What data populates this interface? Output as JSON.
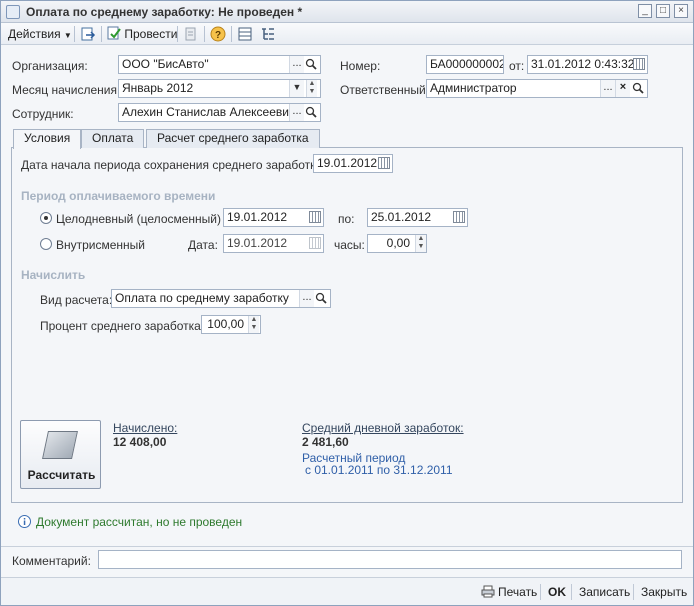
{
  "window": {
    "title": "Оплата по среднему заработку: Не проведен *",
    "controls": {
      "minimize": "_",
      "maximize": "□",
      "close": "×"
    }
  },
  "toolbar": {
    "actions_label": "Действия",
    "post_label": "Провести"
  },
  "header": {
    "org_label": "Организация:",
    "org_value": "ООО \"БисАвто\"",
    "number_label": "Номер:",
    "number_value": "БА000000002",
    "from_label": "от:",
    "date_value": "31.01.2012  0:43:32",
    "month_label": "Месяц начисления:",
    "month_value": "Январь 2012",
    "responsible_label": "Ответственный:",
    "responsible_value": "Администратор",
    "employee_label": "Сотрудник:",
    "employee_value": "Алехин Станислав Алексеевич"
  },
  "tabs": [
    {
      "label": "Условия",
      "active": true
    },
    {
      "label": "Оплата",
      "active": false
    },
    {
      "label": "Расчет среднего заработка",
      "active": false
    }
  ],
  "conditions": {
    "period_start_label": "Дата начала периода сохранения среднего заработка:",
    "period_start_value": "19.01.2012",
    "paid_period_title": "Период оплачиваемого времени",
    "fullday_label": "Целодневный (целосменный) с:",
    "fullday_from": "19.01.2012",
    "to_label": "по:",
    "fullday_to": "25.01.2012",
    "intrashift_label": "Внутрисменный",
    "date_label": "Дата:",
    "intrashift_date": "19.01.2012",
    "hours_label": "часы:",
    "hours_value": "0,00",
    "accrue_title": "Начислить",
    "calc_type_label": "Вид расчета:",
    "calc_type_value": "Оплата по среднему заработку",
    "percent_label": "Процент среднего заработка:",
    "percent_value": "100,00"
  },
  "results": {
    "calc_button_label": "Рассчитать",
    "accrued_label": "Начислено:",
    "accrued_value": "12 408,00",
    "avg_daily_label": "Средний дневной заработок:",
    "avg_daily_value": "2 481,60",
    "calc_period_label": "Расчетный период",
    "calc_period_value": "с 01.01.2011 по 31.12.2011"
  },
  "status_message": "Документ рассчитан, но не проведен",
  "comment": {
    "label": "Комментарий:",
    "value": ""
  },
  "bottom": {
    "print_label": "Печать",
    "ok_label": "OK",
    "save_label": "Записать",
    "close_label": "Закрыть"
  },
  "colors": {
    "accent": "#2f5fa8",
    "status_green": "#2e7a2e",
    "group_title_gray": "#a7b3c2"
  }
}
